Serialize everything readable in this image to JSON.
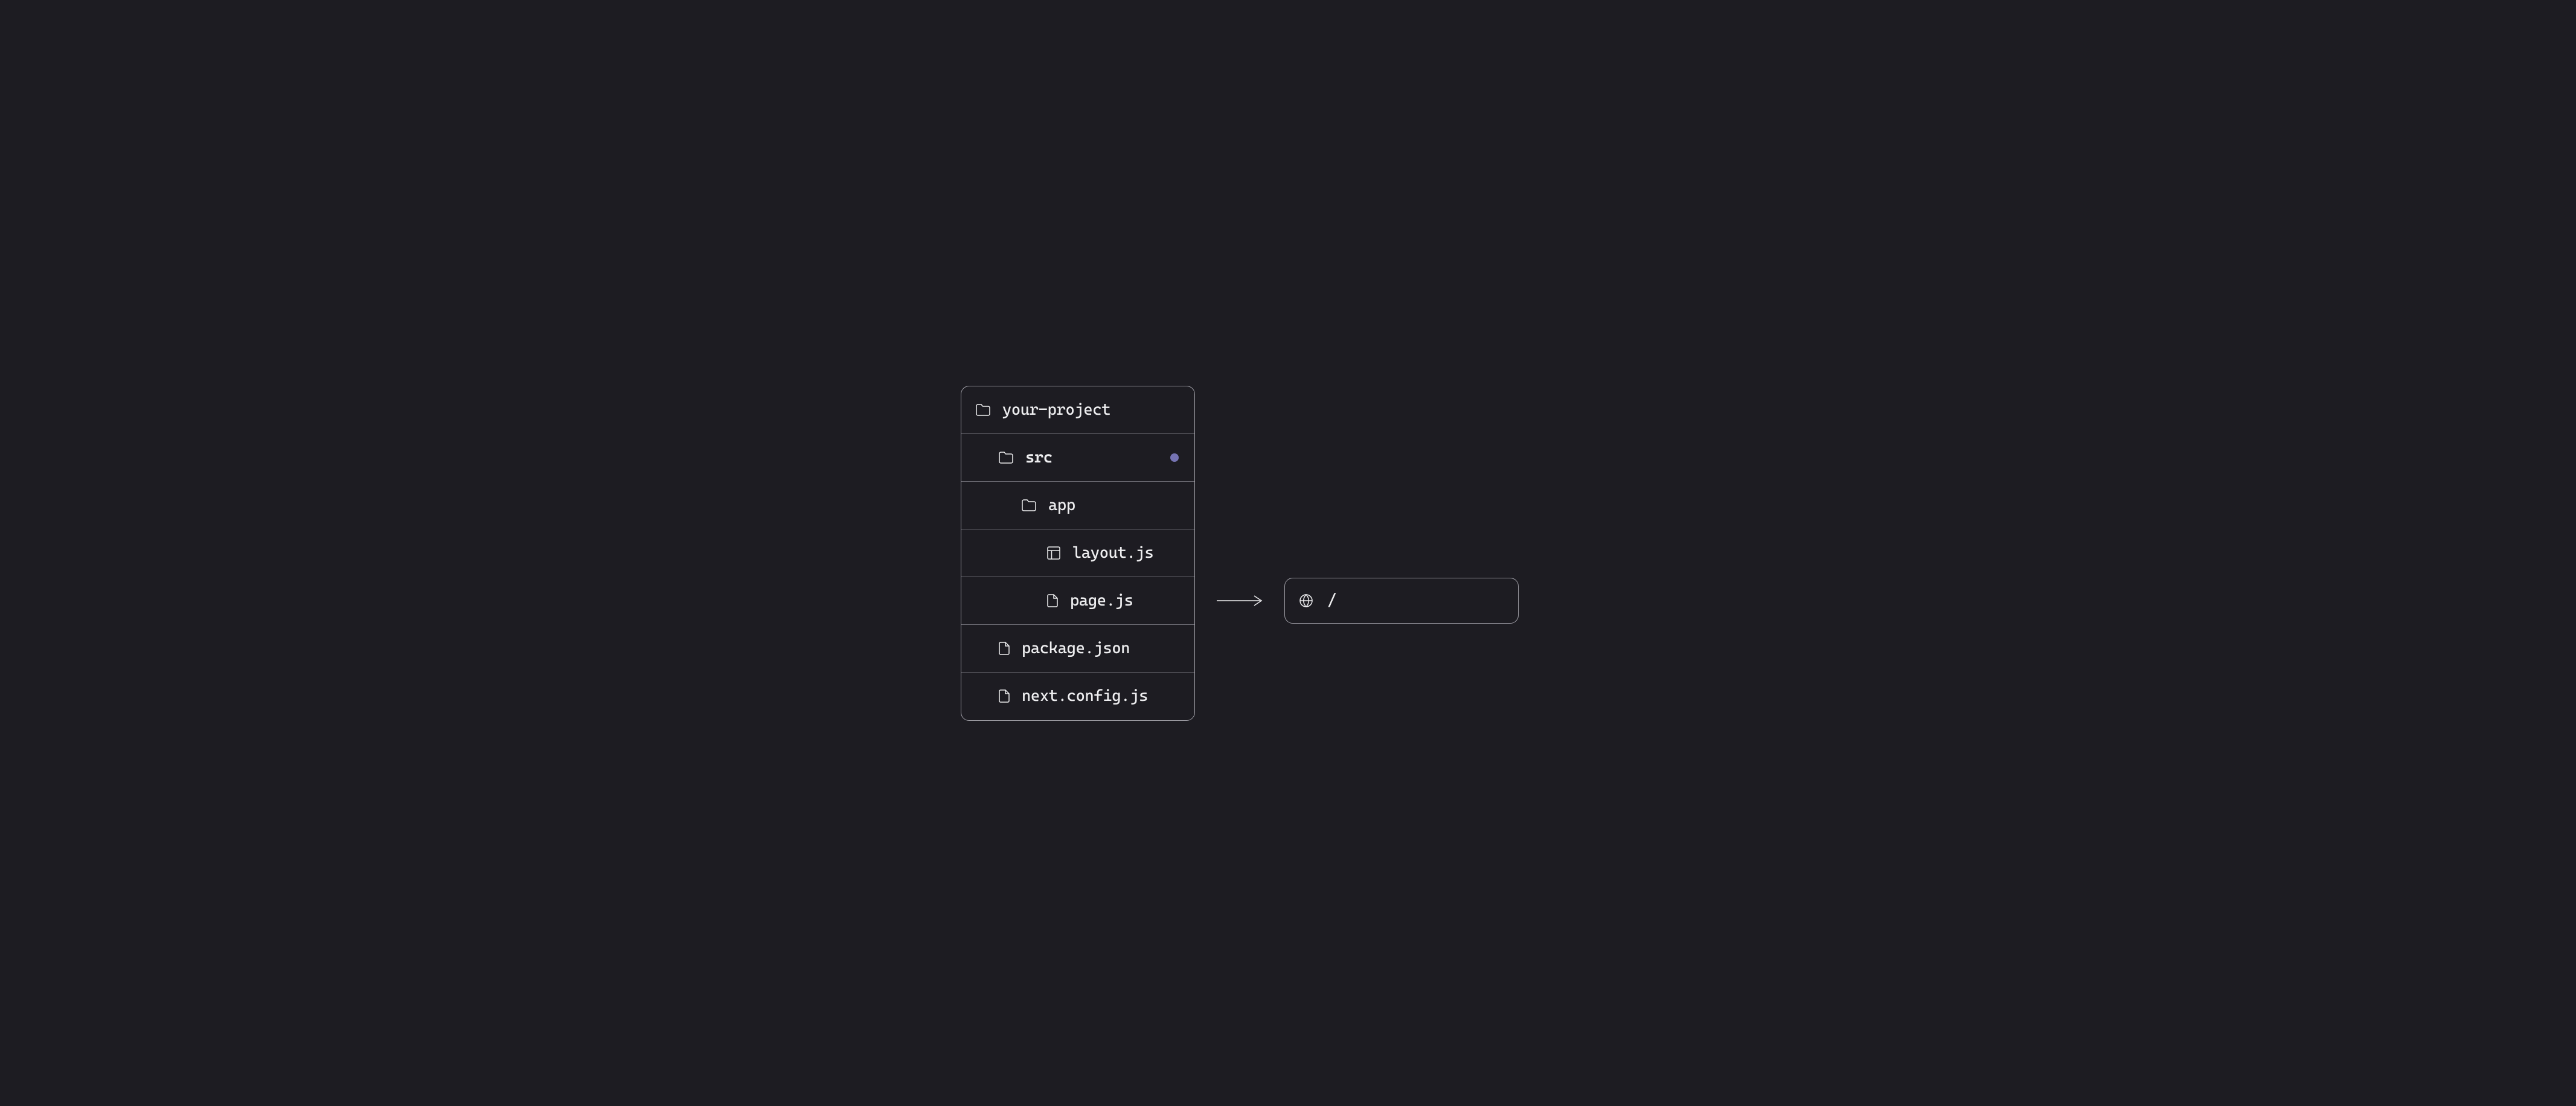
{
  "tree": {
    "root": "your-project",
    "items": [
      {
        "label": "src",
        "type": "folder",
        "indent": 1,
        "highlighted": true
      },
      {
        "label": "app",
        "type": "folder",
        "indent": 2
      },
      {
        "label": "layout.js",
        "type": "layout",
        "indent": 3
      },
      {
        "label": "page.js",
        "type": "file",
        "indent": 3
      },
      {
        "label": "package.json",
        "type": "file",
        "indent": 1
      },
      {
        "label": "next.config.js",
        "type": "file",
        "indent": 1
      }
    ]
  },
  "route": {
    "path": "/"
  }
}
